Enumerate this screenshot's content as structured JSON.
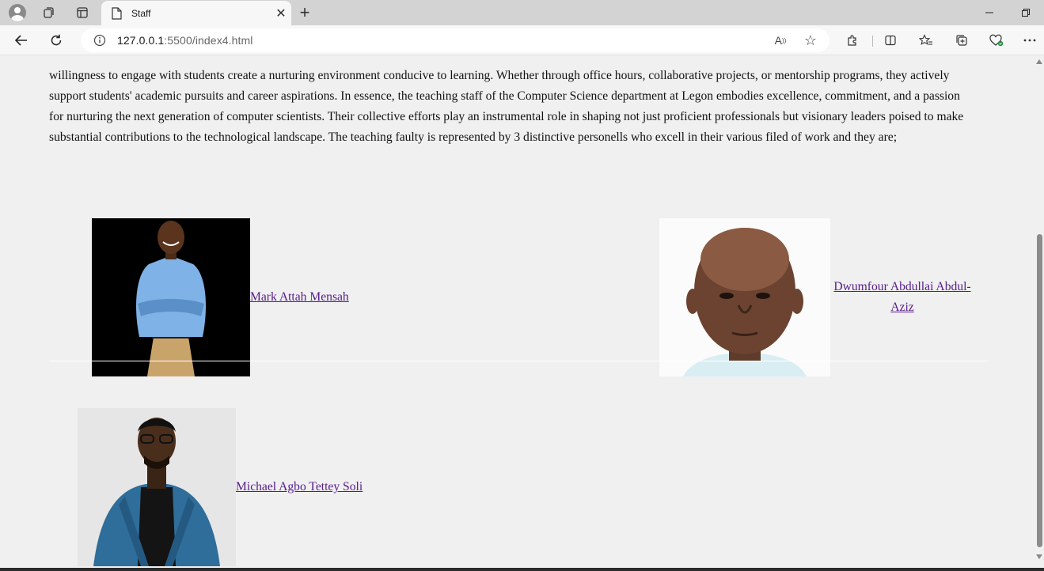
{
  "browser": {
    "tab_title": "Staff",
    "url_host": "127.0.0.1",
    "url_path": ":5500/index4.html",
    "accent": "#551a8b"
  },
  "page": {
    "paragraph_lines": [
      "willingness to engage with students create a nurturing environment conducive to learning. Whether through office hours, collaborative projects, or mentorship programs, they actively",
      "support students' academic pursuits and career aspirations. In essence, the teaching staff of the Computer Science department at Legon embodies excellence, commitment, and a passion",
      "for nurturing the next generation of computer scientists. Their collective efforts play an instrumental role in shaping not just proficient professionals but visionary leaders poised to make",
      "substantial contributions to the technological landscape. The teaching faulty is represented by 3 distinctive personells who excell in their various filed of work and they are;"
    ],
    "staff": [
      {
        "name": "Mark Attah Mensah"
      },
      {
        "name": "Dwumfour Abdullai Abdul-Aziz"
      },
      {
        "name": "Michael Agbo Tettey Soli"
      }
    ]
  }
}
